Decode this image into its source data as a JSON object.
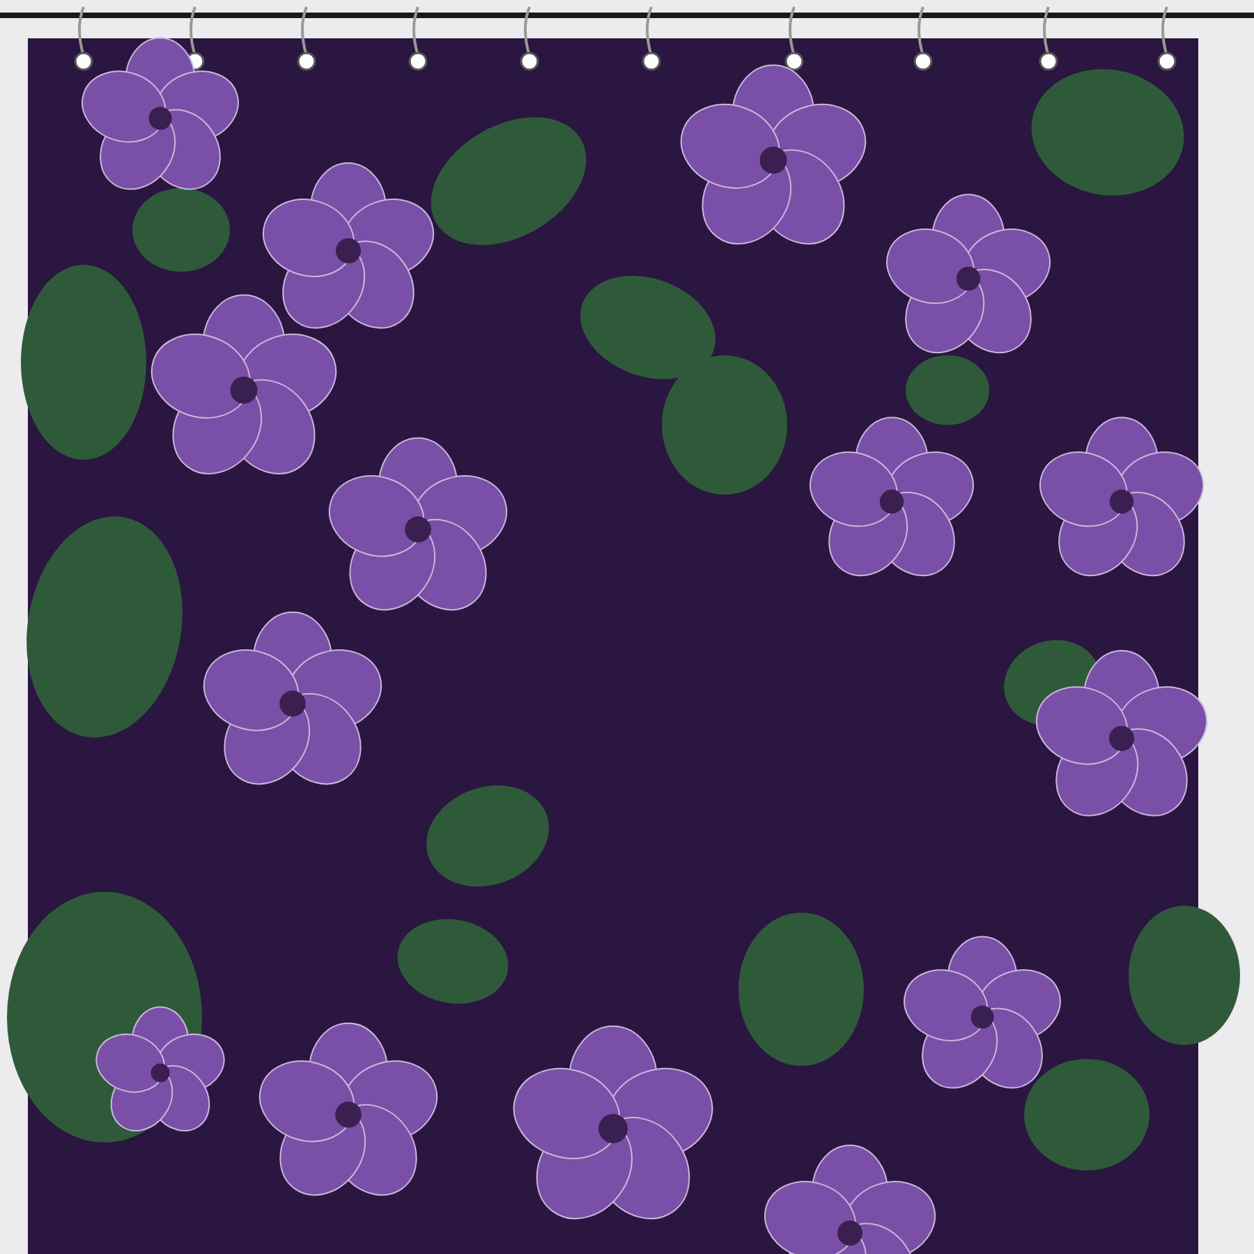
{
  "scene": {
    "kind": "shower-curtain"
  }
}
